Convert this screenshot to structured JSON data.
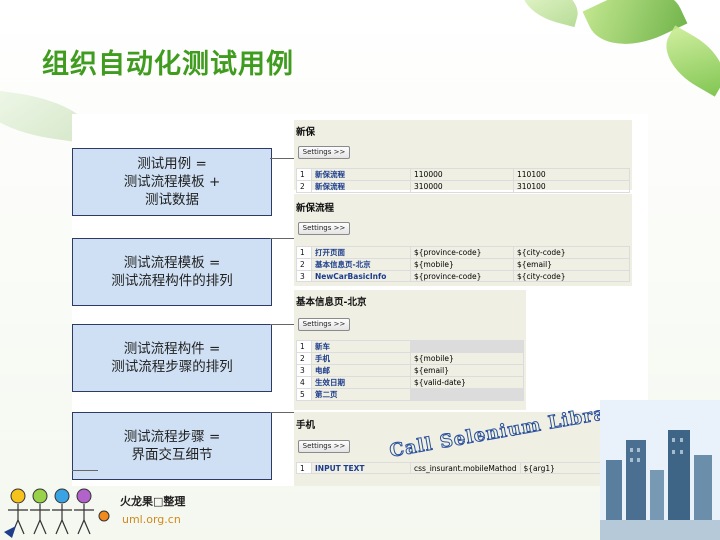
{
  "slide": {
    "title": "组织自动化测试用例"
  },
  "boxes": [
    {
      "line1": "测试用例 =",
      "line2": "测试流程模板 +",
      "line3": "测试数据"
    },
    {
      "line1": "测试流程模板 =",
      "line2": "测试流程构件的排列",
      "line3": ""
    },
    {
      "line1": "测试流程构件 =",
      "line2": "测试流程步骤的排列",
      "line3": ""
    },
    {
      "line1": "测试流程步骤 =",
      "line2": "界面交互细节",
      "line3": ""
    }
  ],
  "screenshot": {
    "settings_label": "Settings >>",
    "sections": [
      {
        "title": "新保",
        "rows": [
          {
            "num": "1",
            "name": "新保流程",
            "c2": "110000",
            "c3": "110100"
          },
          {
            "num": "2",
            "name": "新保流程",
            "c2": "310000",
            "c3": "310100"
          }
        ]
      },
      {
        "title": "新保流程",
        "rows": [
          {
            "num": "1",
            "name": "打开页面",
            "c2": "${province-code}",
            "c3": "${city-code}"
          },
          {
            "num": "2",
            "name": "基本信息页-北京",
            "c2": "${mobile}",
            "c3": "${email}"
          },
          {
            "num": "3",
            "name": "NewCarBasicInfo",
            "c2": "${province-code}",
            "c3": "${city-code}"
          }
        ]
      },
      {
        "title": "基本信息页-北京",
        "rows": [
          {
            "num": "1",
            "name": "新车",
            "c2": ""
          },
          {
            "num": "2",
            "name": "手机",
            "c2": "${mobile}"
          },
          {
            "num": "3",
            "name": "电邮",
            "c2": "${email}"
          },
          {
            "num": "4",
            "name": "生效日期",
            "c2": "${valid-date}"
          },
          {
            "num": "5",
            "name": "第二页",
            "c2": ""
          }
        ]
      },
      {
        "title": "手机",
        "rows": [
          {
            "num": "1",
            "name": "INPUT TEXT",
            "c2": "css_insurant.mobileMathod",
            "c3": "${arg1}"
          }
        ]
      }
    ],
    "watermark": "Call Selenium Library"
  },
  "footer": {
    "name": "火龙果□整理",
    "url": "uml.org.cn"
  },
  "colors": {
    "title": "#3f9c1e",
    "box_fill": "#cfe0f4",
    "box_border": "#2f3a64",
    "keyword": "#1c3c8c"
  }
}
